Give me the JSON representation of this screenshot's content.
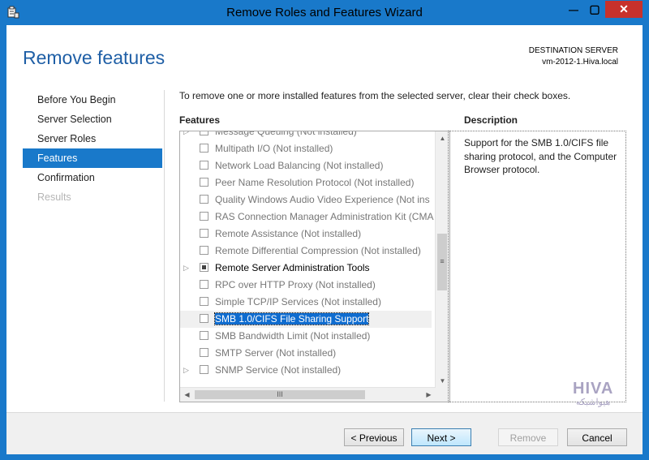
{
  "window": {
    "title": "Remove Roles and Features Wizard",
    "controls": {
      "minimize": "—",
      "maximize": "▢",
      "close": "✕"
    }
  },
  "header": {
    "page_title": "Remove features",
    "destination_label": "DESTINATION SERVER",
    "destination_server": "vm-2012-1.Hiva.local"
  },
  "nav": {
    "items": [
      {
        "label": "Before You Begin",
        "state": "normal"
      },
      {
        "label": "Server Selection",
        "state": "normal"
      },
      {
        "label": "Server Roles",
        "state": "normal"
      },
      {
        "label": "Features",
        "state": "active"
      },
      {
        "label": "Confirmation",
        "state": "normal"
      },
      {
        "label": "Results",
        "state": "disabled"
      }
    ]
  },
  "main": {
    "instruction": "To remove one or more installed features from the selected server, clear their check boxes.",
    "features_label": "Features",
    "description_label": "Description",
    "features": [
      {
        "label": "Message Queuing (Not installed)",
        "expandable": true,
        "checked": "none",
        "installed": false,
        "selected": false
      },
      {
        "label": "Multipath I/O (Not installed)",
        "expandable": false,
        "checked": "none",
        "installed": false,
        "selected": false
      },
      {
        "label": "Network Load Balancing (Not installed)",
        "expandable": false,
        "checked": "none",
        "installed": false,
        "selected": false
      },
      {
        "label": "Peer Name Resolution Protocol (Not installed)",
        "expandable": false,
        "checked": "none",
        "installed": false,
        "selected": false
      },
      {
        "label": "Quality Windows Audio Video Experience (Not ins",
        "expandable": false,
        "checked": "none",
        "installed": false,
        "selected": false
      },
      {
        "label": "RAS Connection Manager Administration Kit (CMA",
        "expandable": false,
        "checked": "none",
        "installed": false,
        "selected": false
      },
      {
        "label": "Remote Assistance (Not installed)",
        "expandable": false,
        "checked": "none",
        "installed": false,
        "selected": false
      },
      {
        "label": "Remote Differential Compression (Not installed)",
        "expandable": false,
        "checked": "none",
        "installed": false,
        "selected": false
      },
      {
        "label": "Remote Server Administration Tools",
        "expandable": true,
        "checked": "partial",
        "installed": true,
        "selected": false
      },
      {
        "label": "RPC over HTTP Proxy (Not installed)",
        "expandable": false,
        "checked": "none",
        "installed": false,
        "selected": false
      },
      {
        "label": "Simple TCP/IP Services (Not installed)",
        "expandable": false,
        "checked": "none",
        "installed": false,
        "selected": false
      },
      {
        "label": "SMB 1.0/CIFS File Sharing Support",
        "expandable": false,
        "checked": "none",
        "installed": true,
        "selected": true
      },
      {
        "label": "SMB Bandwidth Limit (Not installed)",
        "expandable": false,
        "checked": "none",
        "installed": false,
        "selected": false
      },
      {
        "label": "SMTP Server (Not installed)",
        "expandable": false,
        "checked": "none",
        "installed": false,
        "selected": false
      },
      {
        "label": "SNMP Service (Not installed)",
        "expandable": true,
        "checked": "none",
        "installed": false,
        "selected": false
      }
    ],
    "description": "Support for the SMB 1.0/CIFS file sharing protocol, and the Computer Browser protocol."
  },
  "watermark": {
    "line1": "HIVA",
    "line2": "هیواشبکه"
  },
  "footer": {
    "previous": "< Previous",
    "next": "Next >",
    "remove": "Remove",
    "cancel": "Cancel"
  },
  "colors": {
    "accent": "#1979ca",
    "title_text": "#1f5fa6",
    "close_button": "#c7312b",
    "selection": "#0f6ccf"
  },
  "icons": {
    "app": "server-manager-icon",
    "expander": "triangle-right-icon",
    "scroll_up": "chevron-up-icon",
    "scroll_down": "chevron-down-icon",
    "scroll_left": "chevron-left-icon",
    "scroll_right": "chevron-right-icon"
  }
}
